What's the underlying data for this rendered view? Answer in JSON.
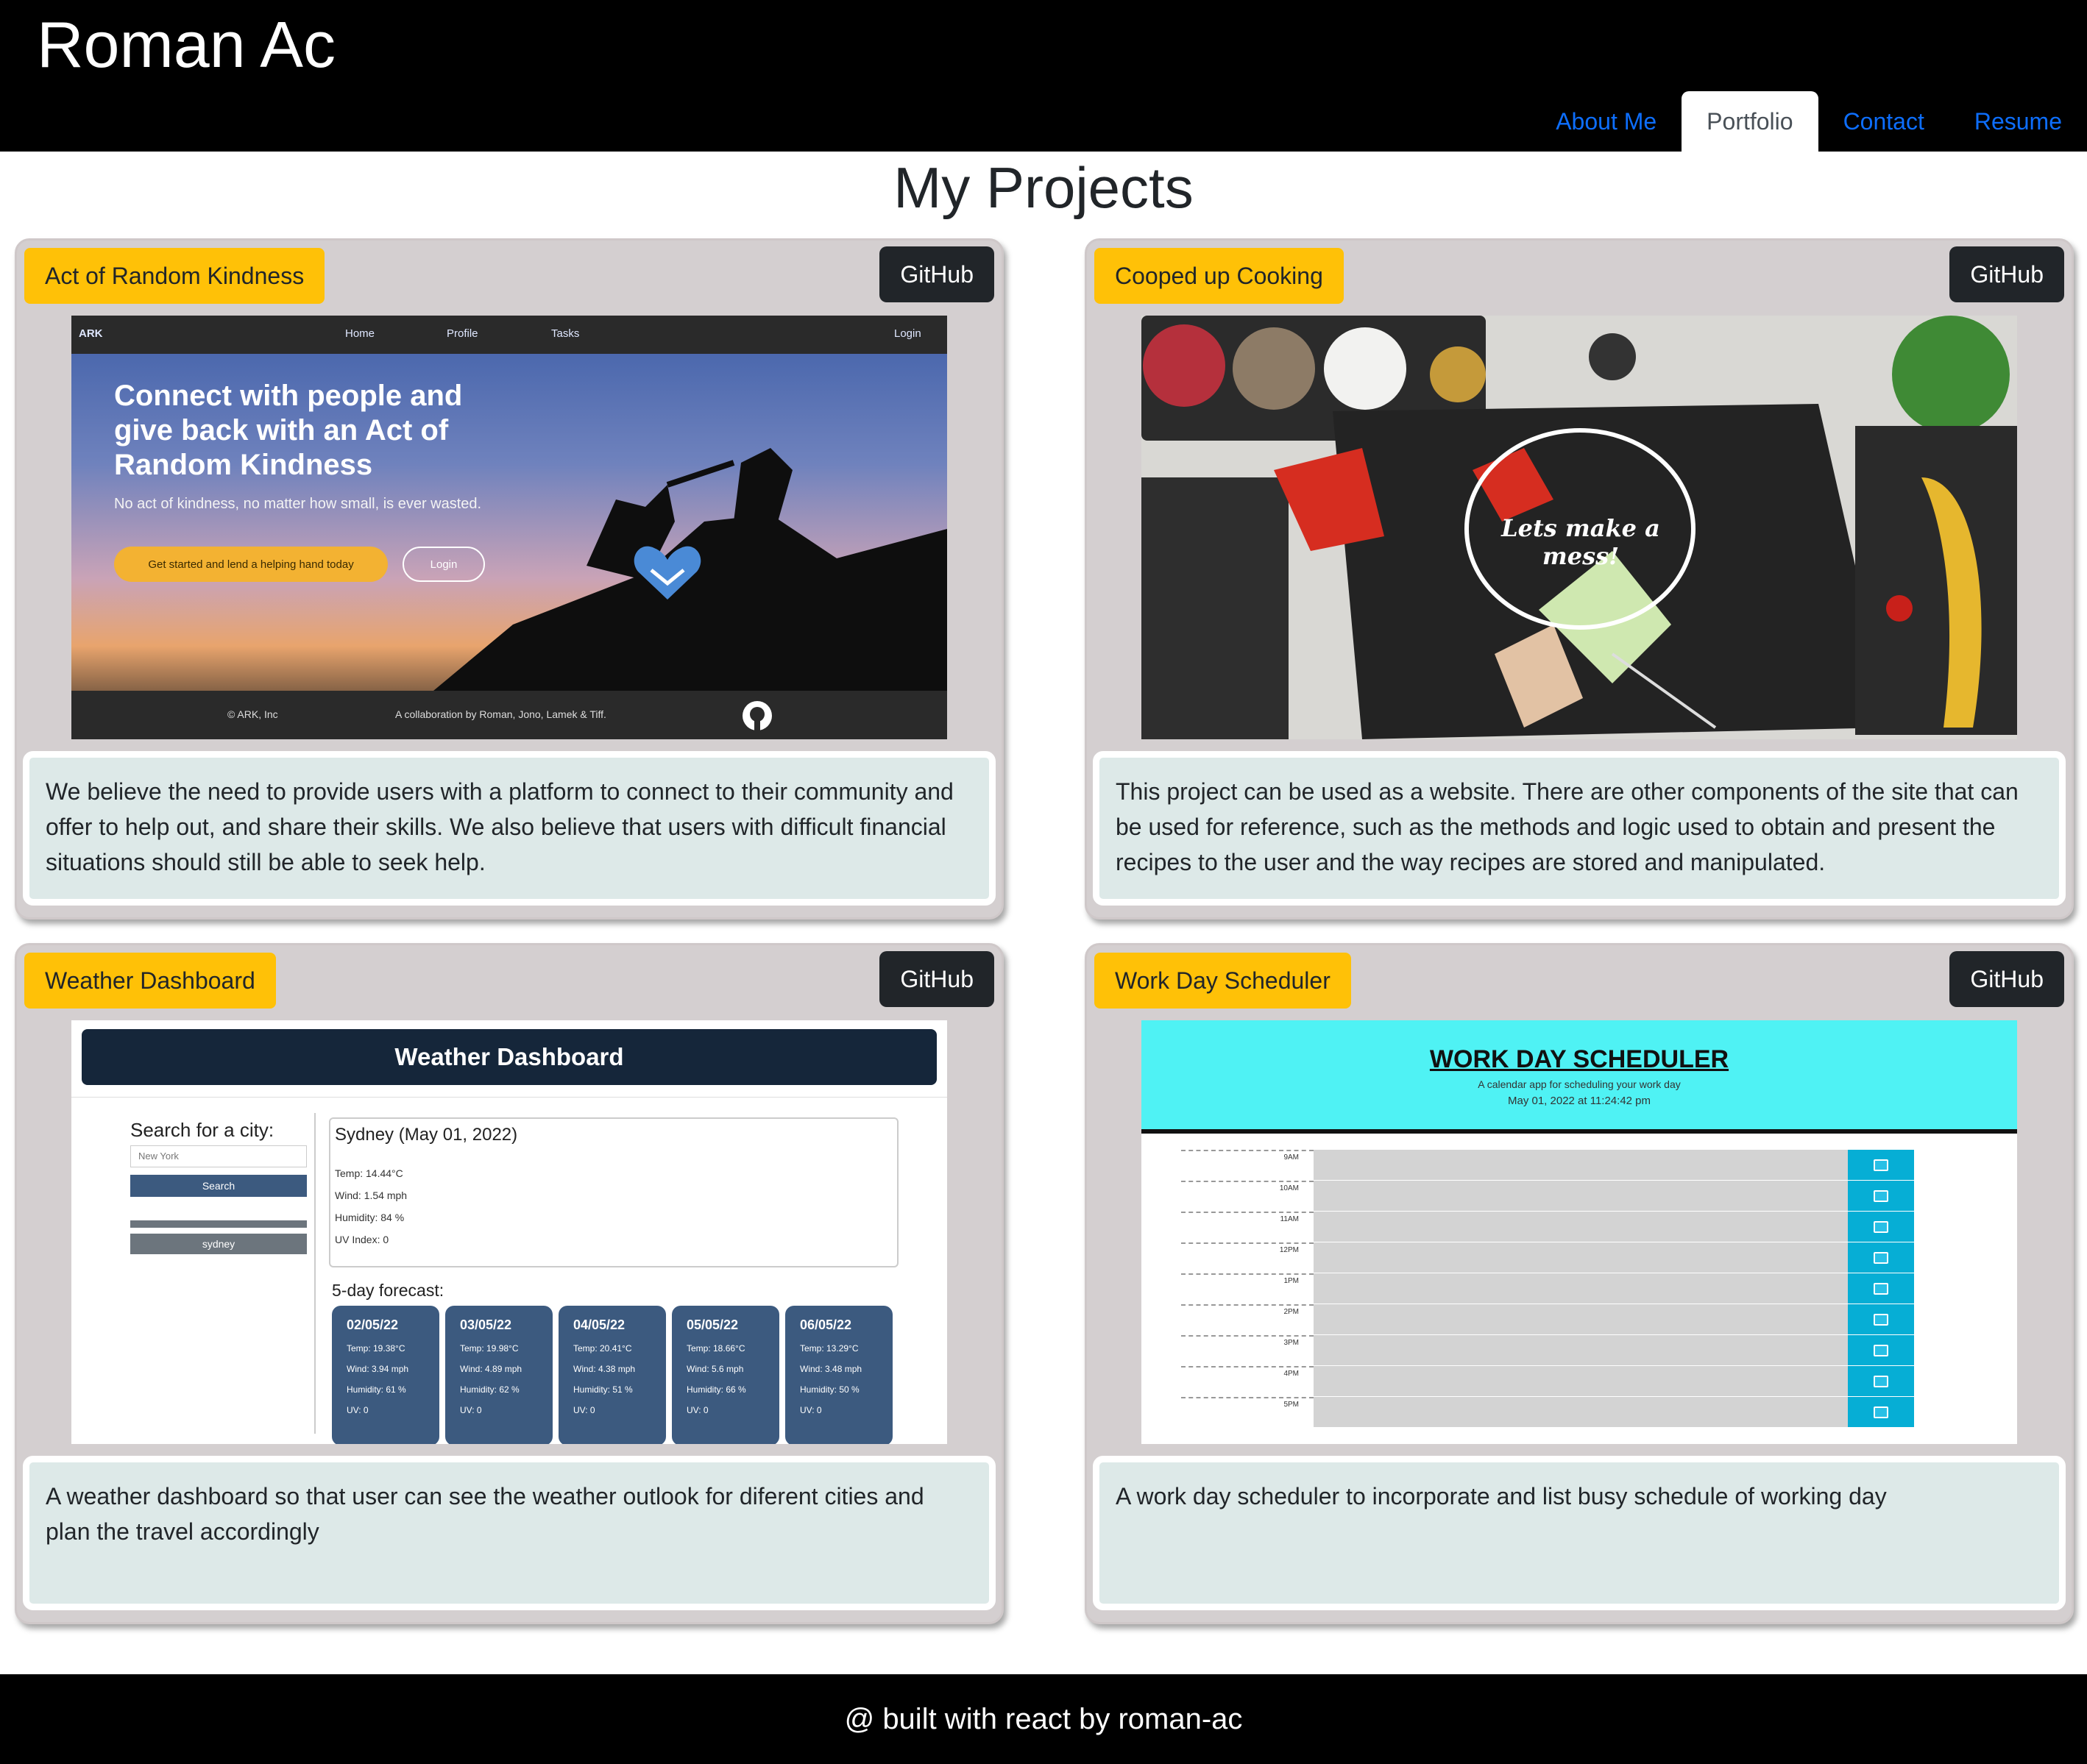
{
  "header": {
    "site_title": "Roman Ac",
    "nav": [
      {
        "label": "About Me",
        "active": false
      },
      {
        "label": "Portfolio",
        "active": true
      },
      {
        "label": "Contact",
        "active": false
      },
      {
        "label": "Resume",
        "active": false
      }
    ]
  },
  "main": {
    "title": "My Projects",
    "projects": [
      {
        "name": "Act of Random Kindness",
        "github_label": "GitHub",
        "description": "We believe the need to provide users with a platform to connect to their community and offer to help out, and share their skills. We also believe that users with difficult financial situations should still be able to seek help.",
        "screenshot": {
          "brand": "ARK",
          "nav": [
            "Home",
            "Profile",
            "Tasks"
          ],
          "login": "Login",
          "headline": "Connect with people and give back with an Act of Random Kindness",
          "subtext": "No act of kindness, no matter how small, is ever wasted.",
          "cta": "Get started and lend a helping hand today",
          "cta2": "Login",
          "footer_left": "© ARK, Inc",
          "footer_mid": "A collaboration by Roman, Jono, Lamek & Tiff."
        }
      },
      {
        "name": "Cooped up Cooking",
        "github_label": "GitHub",
        "description": "This project can be used as a website. There are other components of the site that can be used for reference, such as the methods and logic used to obtain and present the recipes to the user and the way recipes are stored and manipulated.",
        "screenshot": {
          "overlay_text": "Lets make a mess!"
        }
      },
      {
        "name": "Weather Dashboard",
        "github_label": "GitHub",
        "description": "A weather dashboard so that user can see the weather outlook for diferent cities and plan the travel accordingly",
        "screenshot": {
          "title": "Weather Dashboard",
          "search_label": "Search for a city:",
          "search_placeholder": "New York",
          "search_button": "Search",
          "history_item": "sydney",
          "current_title": "Sydney (May 01, 2022)",
          "current_temp": "Temp: 14.44°C",
          "current_wind": "Wind: 1.54 mph",
          "current_humidity": "Humidity: 84 %",
          "current_uv": "UV Index: 0",
          "forecast_label": "5-day forecast:",
          "forecast": [
            {
              "date": "02/05/22",
              "temp": "Temp: 19.38°C",
              "wind": "Wind: 3.94 mph",
              "humidity": "Humidity: 61 %",
              "uv": "UV: 0"
            },
            {
              "date": "03/05/22",
              "temp": "Temp: 19.98°C",
              "wind": "Wind: 4.89 mph",
              "humidity": "Humidity: 62 %",
              "uv": "UV: 0"
            },
            {
              "date": "04/05/22",
              "temp": "Temp: 20.41°C",
              "wind": "Wind: 4.38 mph",
              "humidity": "Humidity: 51 %",
              "uv": "UV: 0"
            },
            {
              "date": "05/05/22",
              "temp": "Temp: 18.66°C",
              "wind": "Wind: 5.6 mph",
              "humidity": "Humidity: 66 %",
              "uv": "UV: 0"
            },
            {
              "date": "06/05/22",
              "temp": "Temp: 13.29°C",
              "wind": "Wind: 3.48 mph",
              "humidity": "Humidity: 50 %",
              "uv": "UV: 0"
            }
          ]
        }
      },
      {
        "name": "Work Day Scheduler",
        "github_label": "GitHub",
        "description": "A work day scheduler to incorporate and list busy schedule of working day",
        "screenshot": {
          "title": "WORK DAY SCHEDULER",
          "subtitle": "A calendar app for scheduling your work day",
          "date": "May 01, 2022 at 11:24:42 pm",
          "hours": [
            "9AM",
            "10AM",
            "11AM",
            "12PM",
            "1PM",
            "2PM",
            "3PM",
            "4PM",
            "5PM"
          ]
        }
      }
    ]
  },
  "footer": {
    "text": "@ built with react by roman-ac"
  },
  "colors": {
    "header_bg": "#000000",
    "nav_link": "#0d6efd",
    "card_bg": "#d4cfd0",
    "label_bg": "#ffc107",
    "github_bg": "#212529",
    "desc_bg": "#dde9e8"
  }
}
